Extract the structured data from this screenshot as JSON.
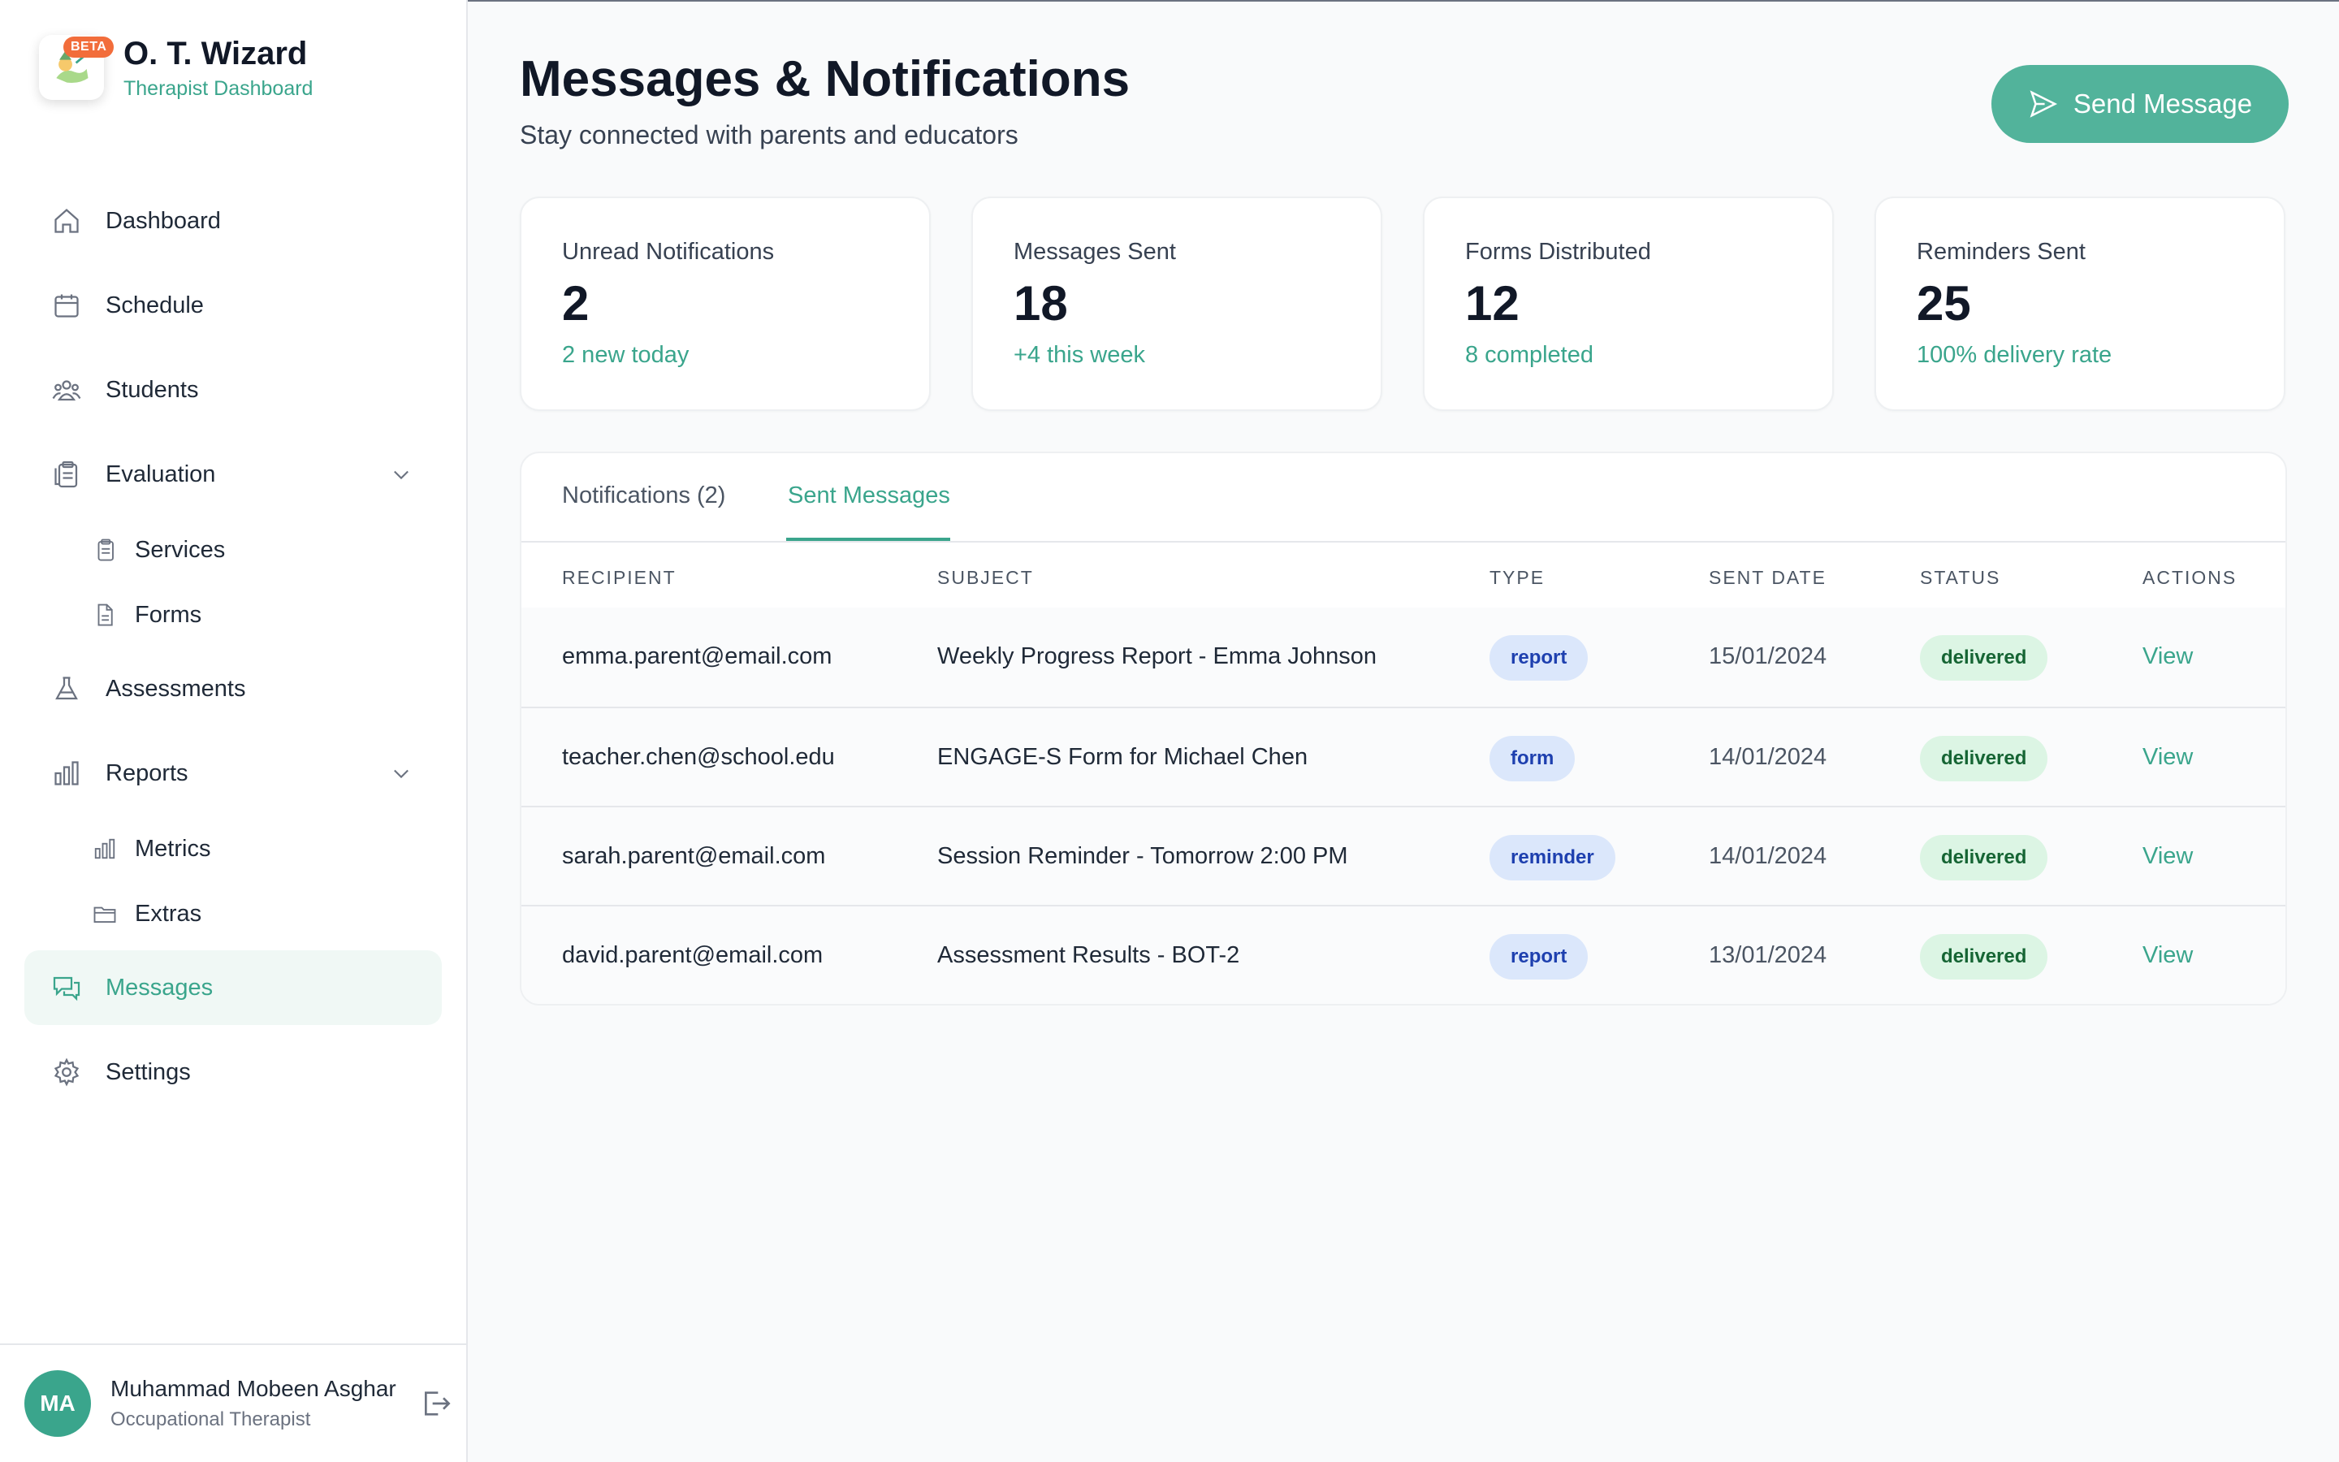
{
  "brand": {
    "badge": "BETA",
    "title": "O. T. Wizard",
    "subtitle": "Therapist Dashboard"
  },
  "nav": {
    "dashboard": "Dashboard",
    "schedule": "Schedule",
    "students": "Students",
    "evaluation": "Evaluation",
    "services": "Services",
    "forms": "Forms",
    "assessments": "Assessments",
    "reports": "Reports",
    "metrics": "Metrics",
    "extras": "Extras",
    "messages": "Messages",
    "settings": "Settings"
  },
  "user": {
    "initials": "MA",
    "name": "Muhammad Mobeen Asghar",
    "role": "Occupational Therapist"
  },
  "header": {
    "title": "Messages & Notifications",
    "subtitle": "Stay connected with parents and educators",
    "send_button": "Send Message"
  },
  "stats": [
    {
      "label": "Unread Notifications",
      "value": "2",
      "note": "2 new today"
    },
    {
      "label": "Messages Sent",
      "value": "18",
      "note": "+4 this week"
    },
    {
      "label": "Forms Distributed",
      "value": "12",
      "note": "8 completed"
    },
    {
      "label": "Reminders Sent",
      "value": "25",
      "note": "100% delivery rate"
    }
  ],
  "tabs": {
    "notifications": "Notifications (2)",
    "sent": "Sent Messages"
  },
  "table": {
    "headers": {
      "recipient": "RECIPIENT",
      "subject": "SUBJECT",
      "type": "TYPE",
      "sent_date": "SENT DATE",
      "status": "STATUS",
      "actions": "ACTIONS"
    },
    "rows": [
      {
        "recipient": "emma.parent@email.com",
        "subject": "Weekly Progress Report - Emma Johnson",
        "type": "report",
        "date": "15/01/2024",
        "status": "delivered",
        "action": "View"
      },
      {
        "recipient": "teacher.chen@school.edu",
        "subject": "ENGAGE-S Form for Michael Chen",
        "type": "form",
        "date": "14/01/2024",
        "status": "delivered",
        "action": "View"
      },
      {
        "recipient": "sarah.parent@email.com",
        "subject": "Session Reminder - Tomorrow 2:00 PM",
        "type": "reminder",
        "date": "14/01/2024",
        "status": "delivered",
        "action": "View"
      },
      {
        "recipient": "david.parent@email.com",
        "subject": "Assessment Results - BOT-2",
        "type": "report",
        "date": "13/01/2024",
        "status": "delivered",
        "action": "View"
      }
    ]
  },
  "colors": {
    "accent": "#3aa58c",
    "button": "#52b39b",
    "beta": "#f26d3b"
  }
}
